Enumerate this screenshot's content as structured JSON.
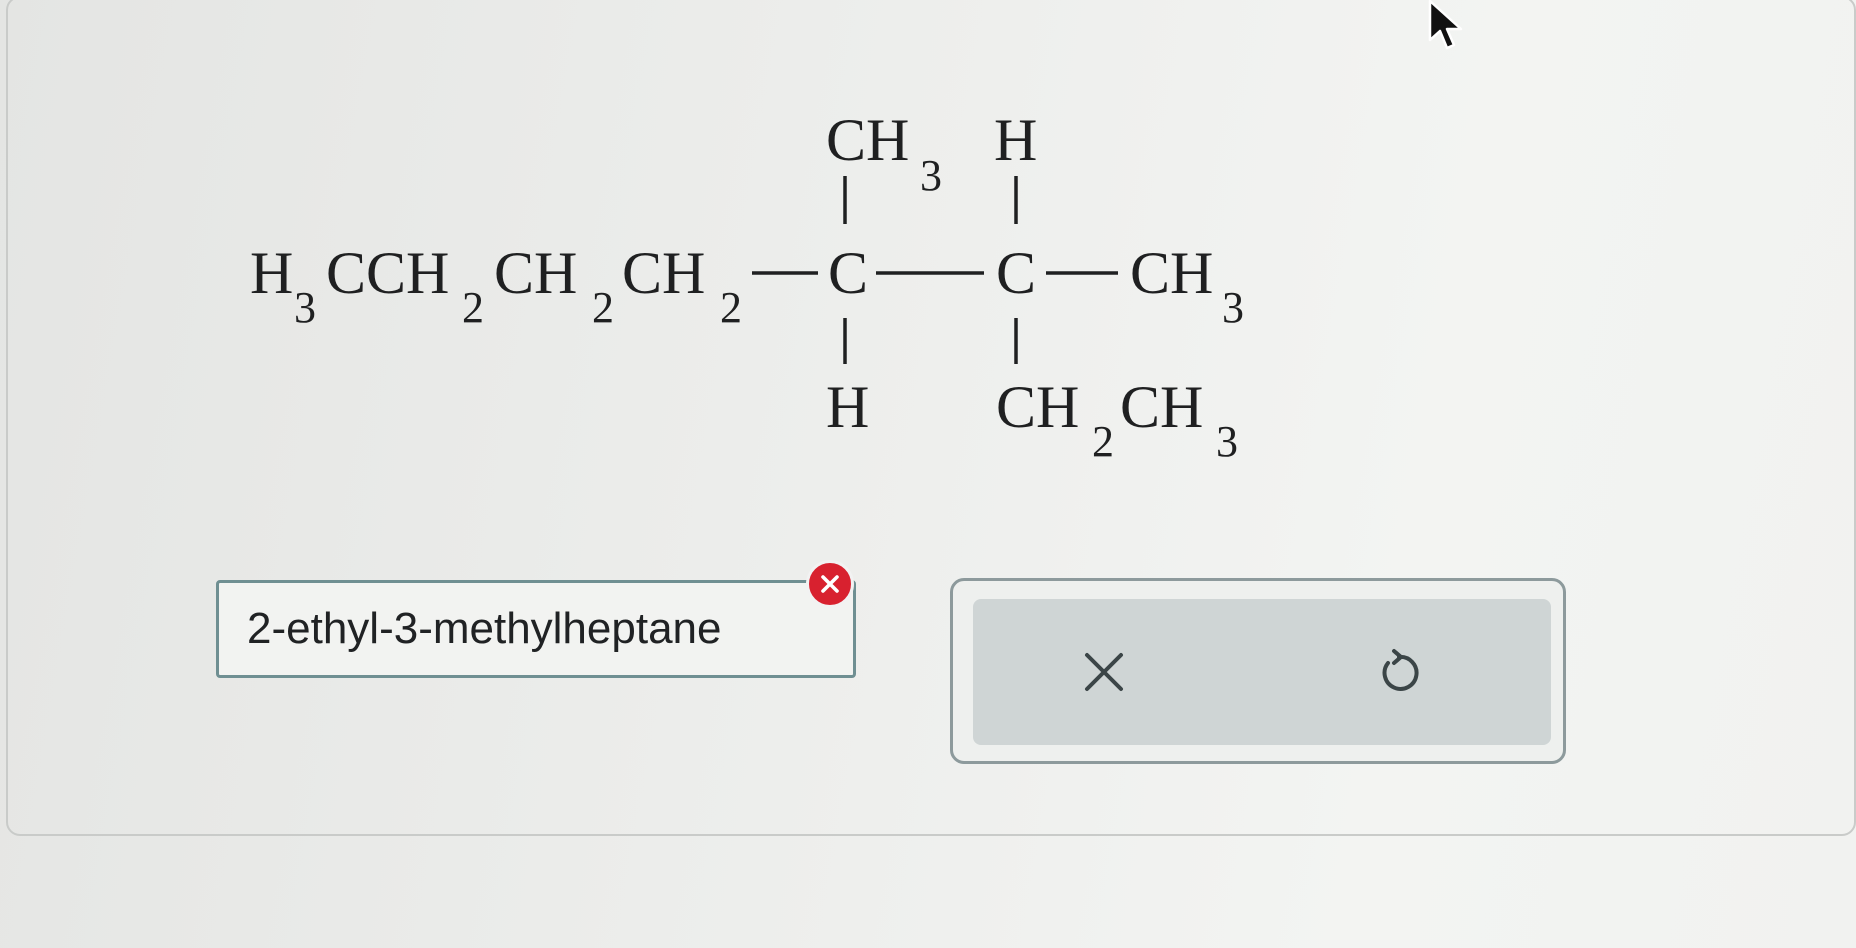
{
  "molecule": {
    "chain_prefix": "H",
    "chain_prefix_sub": "3",
    "chain_c": "CCH",
    "chain_sub1": "2",
    "chain_ch_a": "CH",
    "chain_sub2": "2",
    "chain_ch_b": "CH",
    "chain_sub3": "2",
    "c1_label": "C",
    "c1_top": "CH",
    "c1_top_sub": "3",
    "c1_bottom": "H",
    "c2_label": "C",
    "c2_top": "H",
    "c2_right": "CH",
    "c2_right_sub": "3",
    "c2_bottom_a": "CH",
    "c2_bottom_a_sub": "2",
    "c2_bottom_b": "CH",
    "c2_bottom_b_sub": "3"
  },
  "answer": {
    "value": "2-ethyl-3-methylheptane",
    "status": "incorrect",
    "status_color": "#d8212f"
  },
  "actions": {
    "clear_icon": "x-icon",
    "undo_icon": "undo-icon"
  }
}
